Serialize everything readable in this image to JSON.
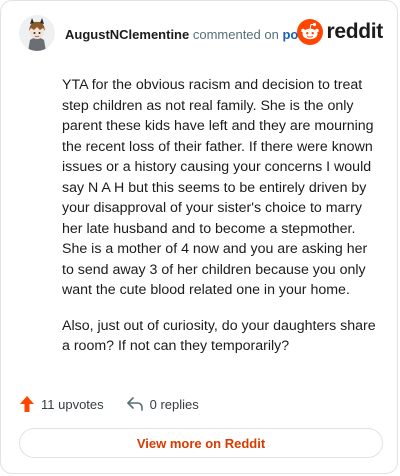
{
  "header": {
    "username": "AugustNClementine",
    "action_text": " commented on ",
    "post_link": "post",
    "brand_name": "reddit",
    "brand_color": "#ff4500"
  },
  "comment": {
    "paragraphs": [
      "YTA for the obvious racism and decision to treat step children as not real family. She is the only parent these kids have left and they are mourning the recent loss of their father. If there were known issues or a history causing your concerns I would say N A H but this seems to be entirely driven by your disapproval of your sister's choice to marry her late husband and to become a stepmother. She is a mother of 4 now and you are asking her to send away 3 of her children because you only want the cute blood related one in your home.",
      "Also, just out of curiosity, do your daughters share a room? If not can they temporarily?"
    ]
  },
  "actions": {
    "upvotes": "11 upvotes",
    "replies": "0 replies",
    "upvote_icon": "arrow-up-icon",
    "reply_icon": "reply-arrow-icon"
  },
  "footer": {
    "view_more": "View more on Reddit",
    "accent_color": "#d93a00"
  }
}
